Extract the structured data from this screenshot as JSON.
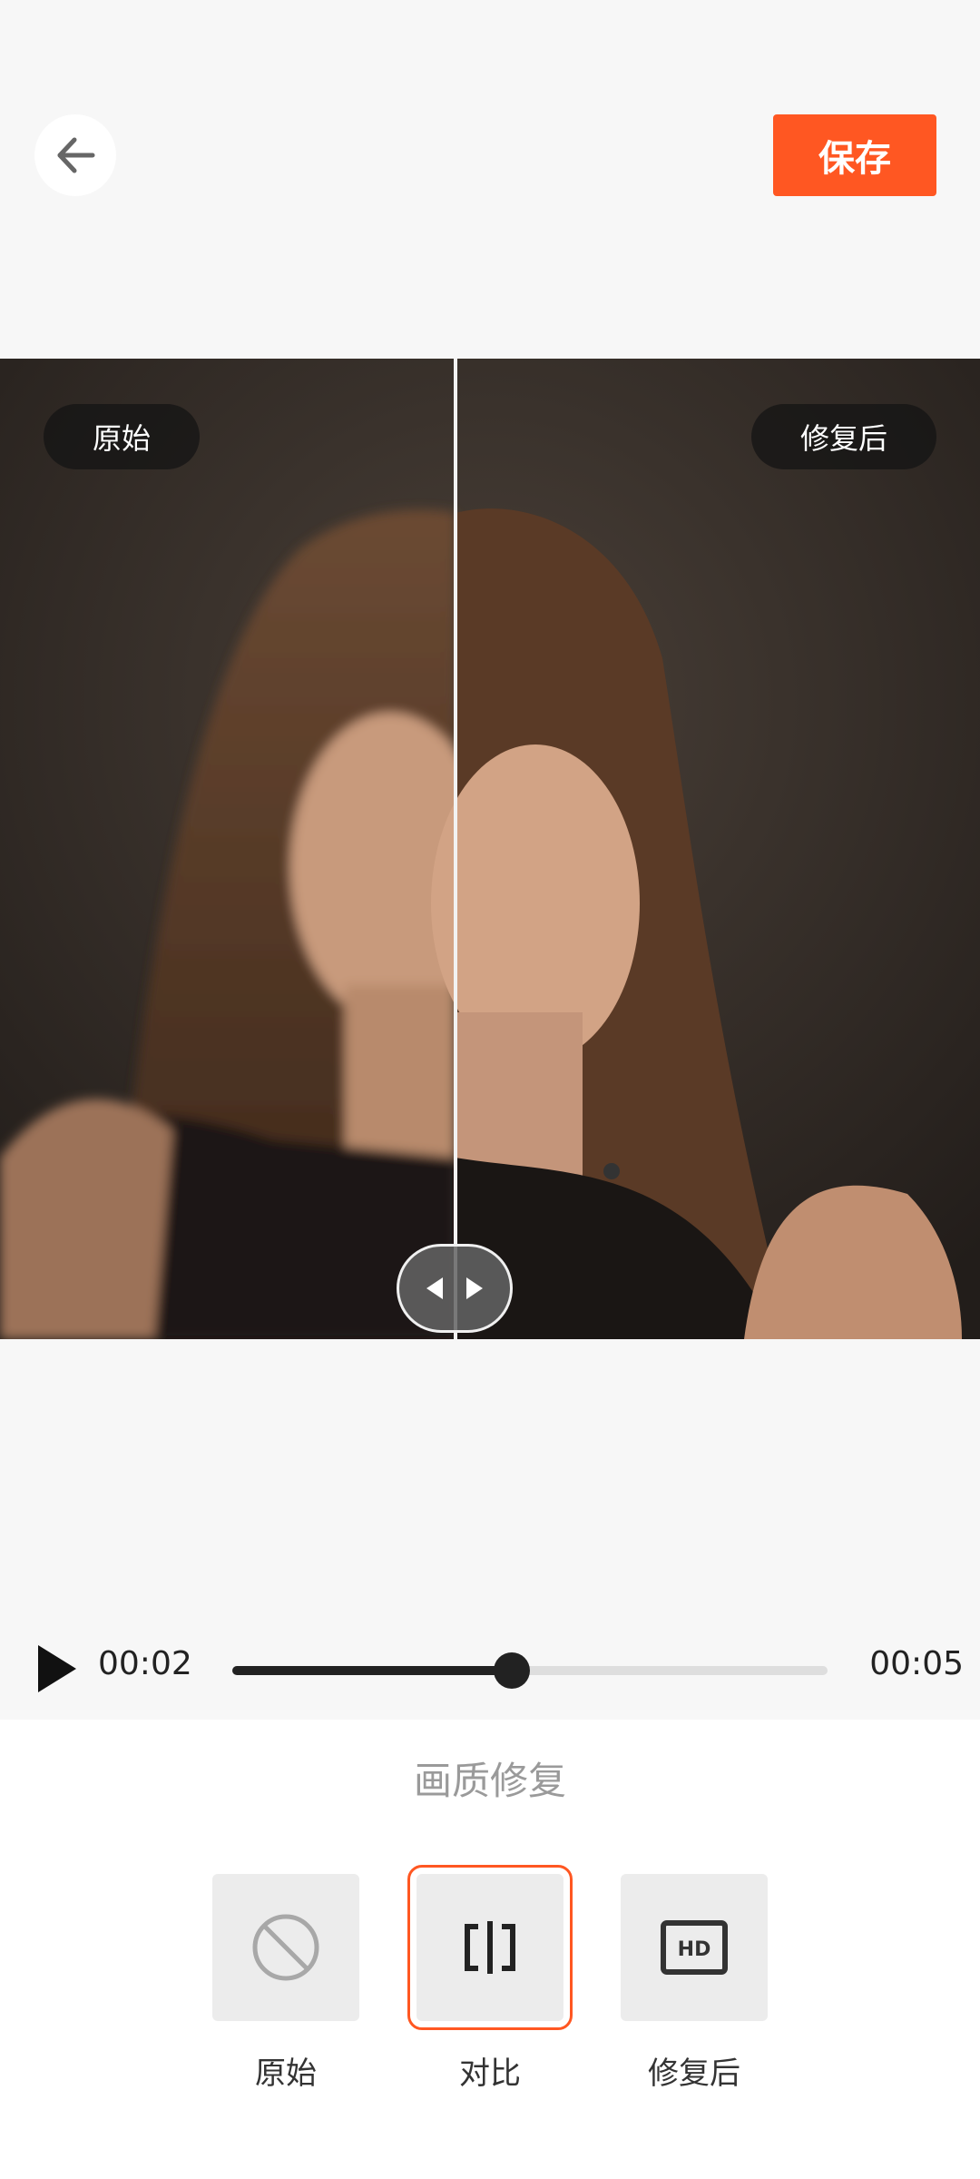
{
  "header": {
    "back_icon": "arrow-left-icon",
    "save_label": "保存",
    "accent_color": "#ff5722"
  },
  "viewer": {
    "left_tag": "原始",
    "right_tag": "修复后",
    "handle_icon": "split-handle-icon"
  },
  "player": {
    "play_icon": "play-icon",
    "current_time": "00:02",
    "total_time": "00:05",
    "progress": 0.47
  },
  "panel": {
    "title": "画质修复",
    "options": [
      {
        "label": "原始",
        "icon": "no-effect-icon",
        "selected": false
      },
      {
        "label": "对比",
        "icon": "compare-icon",
        "selected": true
      },
      {
        "label": "修复后",
        "icon": "hd-icon",
        "selected": false
      }
    ]
  }
}
